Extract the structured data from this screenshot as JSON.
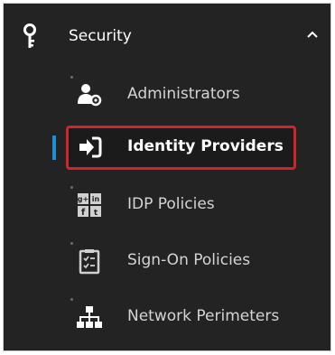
{
  "header": {
    "icon": "key-icon",
    "label": "Security",
    "chevron": "chevron-up-icon",
    "expanded": true
  },
  "items": [
    {
      "label": "Administrators",
      "icon": "admin-user-gear-icon",
      "active": false
    },
    {
      "label": "Identity Providers",
      "icon": "sign-in-arrow-icon",
      "active": true
    },
    {
      "label": "IDP Policies",
      "icon": "social-logos-icon",
      "active": false
    },
    {
      "label": "Sign-On Policies",
      "icon": "checklist-clipboard-icon",
      "active": false
    },
    {
      "label": "Network Perimeters",
      "icon": "network-hierarchy-icon",
      "active": false
    }
  ],
  "colors": {
    "background": "#232323",
    "text": "#d4d4d4",
    "active_indicator": "#1c8fd6",
    "highlight_border": "#d2232a"
  }
}
